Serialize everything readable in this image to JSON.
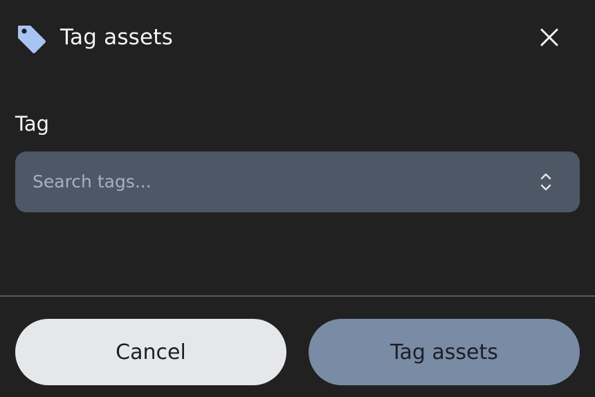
{
  "dialog": {
    "title": "Tag assets",
    "title_icon": "tag-icon",
    "close_icon": "close-icon"
  },
  "form": {
    "tag_label": "Tag",
    "tag_select": {
      "placeholder": "Search tags...",
      "icon": "chevron-up-down-icon"
    }
  },
  "footer": {
    "cancel_label": "Cancel",
    "submit_label": "Tag assets"
  },
  "colors": {
    "background": "#212121",
    "icon_accent": "#a8c4f2",
    "select_bg": "#4e5766",
    "cancel_bg": "#e6e7ea",
    "primary_bg": "#7a8ba6"
  }
}
